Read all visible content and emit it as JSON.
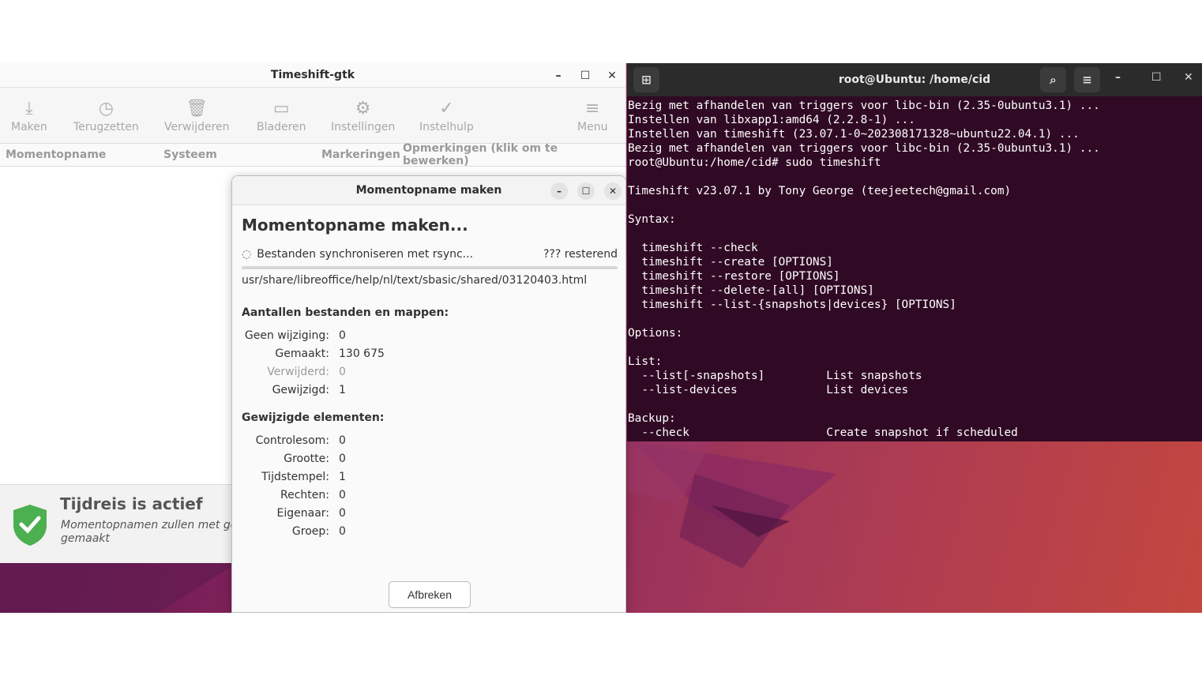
{
  "main_window": {
    "title": "Timeshift-gtk",
    "toolbar": [
      {
        "label": "Maken",
        "icon": "download-icon"
      },
      {
        "label": "Terugzetten",
        "icon": "history-icon"
      },
      {
        "label": "Verwijderen",
        "icon": "trash-icon"
      },
      {
        "label": "Bladeren",
        "icon": "folder-icon"
      },
      {
        "label": "Instellingen",
        "icon": "gear-icon"
      },
      {
        "label": "Instelhulp",
        "icon": "check-circle-icon"
      },
      {
        "label": "Menu",
        "icon": "hamburger-icon"
      }
    ],
    "columns": [
      "Momentopname",
      "Systeem",
      "Markeringen",
      "Opmerkingen (klik om te bewerken)"
    ],
    "status": {
      "title": "Tijdreis is actief",
      "line1": "Momentopnamen zullen met geka",
      "line2": "gemaakt"
    }
  },
  "dialog": {
    "title": "Momentopname maken",
    "heading": "Momentopname maken...",
    "progress_text": "Bestanden synchroniseren met rsync...",
    "remaining": "??? resterend",
    "progress": 0.0,
    "current_file": "usr/share/libreoffice/help/nl/text/sbasic/shared/03120403.html",
    "counts_header": "Aantallen bestanden en mappen:",
    "counts": [
      {
        "k": "Geen wijziging:",
        "v": "0"
      },
      {
        "k": "Gemaakt:",
        "v": "130 675"
      },
      {
        "k": "Verwijderd:",
        "v": "0"
      },
      {
        "k": "Gewijzigd:",
        "v": "1"
      }
    ],
    "changed_header": "Gewijzigde elementen:",
    "changed": [
      {
        "k": "Controlesom:",
        "v": "0"
      },
      {
        "k": "Grootte:",
        "v": "0"
      },
      {
        "k": "Tijdstempel:",
        "v": "1"
      },
      {
        "k": "Rechten:",
        "v": "0"
      },
      {
        "k": "Eigenaar:",
        "v": "0"
      },
      {
        "k": "Groep:",
        "v": "0"
      }
    ],
    "cancel": "Afbreken"
  },
  "terminal": {
    "title": "root@Ubuntu: /home/cid",
    "lines": [
      "Bezig met afhandelen van triggers voor libc-bin (2.35-0ubuntu3.1) ...",
      "Instellen van libxapp1:amd64 (2.2.8-1) ...",
      "Instellen van timeshift (23.07.1-0~202308171328~ubuntu22.04.1) ...",
      "Bezig met afhandelen van triggers voor libc-bin (2.35-0ubuntu3.1) ...",
      "root@Ubuntu:/home/cid# sudo timeshift",
      "",
      "Timeshift v23.07.1 by Tony George (teejeetech@gmail.com)",
      "",
      "Syntax:",
      "",
      "  timeshift --check",
      "  timeshift --create [OPTIONS]",
      "  timeshift --restore [OPTIONS]",
      "  timeshift --delete-[all] [OPTIONS]",
      "  timeshift --list-{snapshots|devices} [OPTIONS]",
      "",
      "Options:",
      "",
      "List:",
      "  --list[-snapshots]         List snapshots",
      "  --list-devices             List devices",
      "",
      "Backup:",
      "  --check                    Create snapshot if scheduled"
    ]
  }
}
